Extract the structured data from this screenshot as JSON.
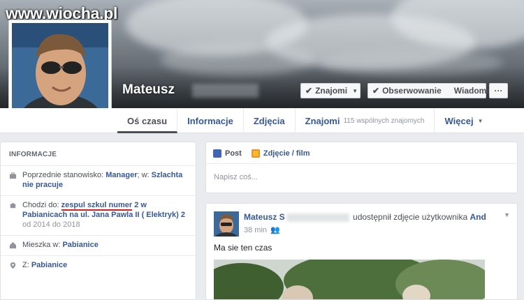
{
  "watermark": "www.wiocha.pl",
  "profile": {
    "name": "Mateusz"
  },
  "cover_buttons": {
    "friends": "Znajomi",
    "following": "Obserwowanie",
    "message": "Wiadomość",
    "more": "···"
  },
  "nav": {
    "timeline": "Oś czasu",
    "about": "Informacje",
    "photos": "Zdjęcia",
    "friends": "Znajomi",
    "friends_sub": "115 wspólnych znajomych",
    "more": "Więcej"
  },
  "info": {
    "title": "INFORMACJE",
    "work": {
      "prefix": "Poprzednie stanowisko: ",
      "position": "Manager",
      "mid": "; w: ",
      "place": "Szlachta nie pracuje"
    },
    "school": {
      "prefix": "Chodzi do: ",
      "name_underlined": "zespul szkul numer",
      "name_rest": " 2 w Pabianicach na ul. Jana Pawla II ( Elektryk) 2",
      "dates": "od 2014 do 2018"
    },
    "lives": {
      "prefix": "Mieszka w: ",
      "place": "Pabianice"
    },
    "from": {
      "prefix": "Z: ",
      "place": "Pabianice"
    }
  },
  "composer": {
    "tab_post": "Post",
    "tab_photo": "Zdjęcie / film",
    "placeholder": "Napisz coś..."
  },
  "feed": {
    "author": "Mateusz S",
    "action": "udostępnił zdjęcie użytkownika",
    "target": "And",
    "time": "38 min",
    "text": "Ma sie ten czas"
  },
  "colors": {
    "link": "#365899",
    "underline": "#d0231d",
    "background": "#e9ebee"
  }
}
